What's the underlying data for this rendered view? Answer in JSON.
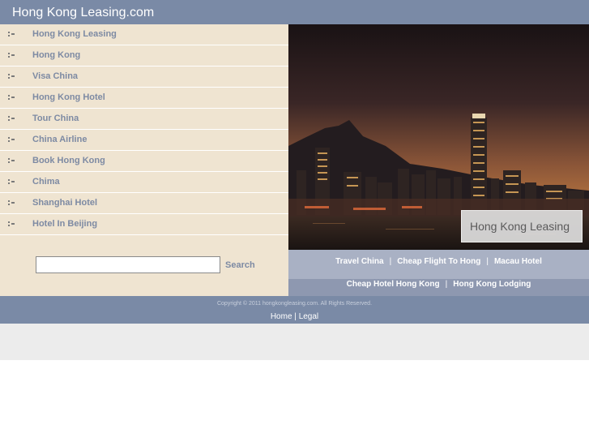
{
  "header": {
    "site_title": "Hong Kong Leasing.com"
  },
  "nav": {
    "items": [
      {
        "label": "Hong Kong Leasing"
      },
      {
        "label": "Hong Kong"
      },
      {
        "label": "Visa China"
      },
      {
        "label": "Hong Kong Hotel"
      },
      {
        "label": "Tour China"
      },
      {
        "label": "China Airline"
      },
      {
        "label": "Book Hong Kong"
      },
      {
        "label": "Chima"
      },
      {
        "label": "Shanghai Hotel"
      },
      {
        "label": "Hotel In Beijing"
      }
    ]
  },
  "search": {
    "value": "",
    "button_label": "Search"
  },
  "hero": {
    "caption": "Hong Kong Leasing"
  },
  "links": {
    "row1": [
      "Travel China",
      "Cheap Flight To Hong",
      "Macau Hotel"
    ],
    "row2": [
      "Cheap Hotel Hong Kong",
      "Hong Kong Lodging"
    ],
    "separator": "|"
  },
  "footer": {
    "copyright": "Copyright © 2011 hongkongleasing.com. All Rights Reserved.",
    "home_label": "Home",
    "separator": "|",
    "legal_label": "Legal"
  },
  "colors": {
    "header_bg": "#7a8aa6",
    "sidebar_bg": "#efe4d1",
    "link_color": "#7d8aa3",
    "links_bar_bg": "#a9b1c4"
  }
}
